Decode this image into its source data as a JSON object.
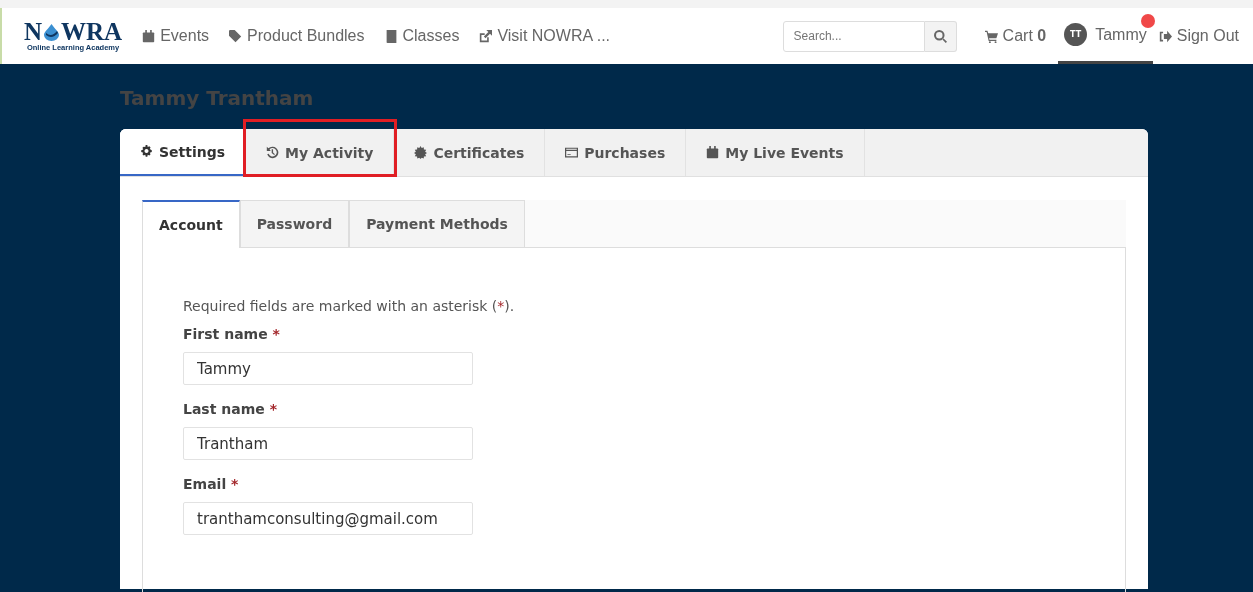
{
  "logo": {
    "left": "N",
    "right": "WRA",
    "subtitle": "Online Learning Academy"
  },
  "nav": [
    {
      "label": "Events"
    },
    {
      "label": "Product Bundles"
    },
    {
      "label": "Classes"
    },
    {
      "label": "Visit NOWRA ..."
    }
  ],
  "search": {
    "placeholder": "Search..."
  },
  "cart": {
    "label": "Cart **0**"
  },
  "user": {
    "initials": "TT",
    "name": "Tammy",
    "selected": true,
    "notification": true
  },
  "sign_out": {
    "label": "Sign Out"
  },
  "profile_name": "Tammy Trantham",
  "tabs": [
    {
      "label": "Settings",
      "selected": true,
      "highlighted": false
    },
    {
      "label": "My Activity",
      "selected": false,
      "highlighted": true
    },
    {
      "label": "Certificates",
      "selected": false,
      "highlighted": false
    },
    {
      "label": "Purchases",
      "selected": false,
      "highlighted": false
    },
    {
      "label": "My Live Events",
      "selected": false,
      "highlighted": false
    }
  ],
  "subtabs": [
    {
      "label": "Account",
      "selected": true
    },
    {
      "label": "Password",
      "selected": false
    },
    {
      "label": "Payment Methods",
      "selected": false
    }
  ],
  "note": {
    "before": "Required fields are marked with an asterisk (",
    "mark": "*",
    "after": ")."
  },
  "fields": [
    {
      "label": "First name",
      "mark": "*",
      "value": "Tammy"
    },
    {
      "label": "Last name",
      "mark": "*",
      "value": "Trantham"
    },
    {
      "label": "Email",
      "mark": "*",
      "value": "tranthamconsulting@gmail.com"
    }
  ]
}
